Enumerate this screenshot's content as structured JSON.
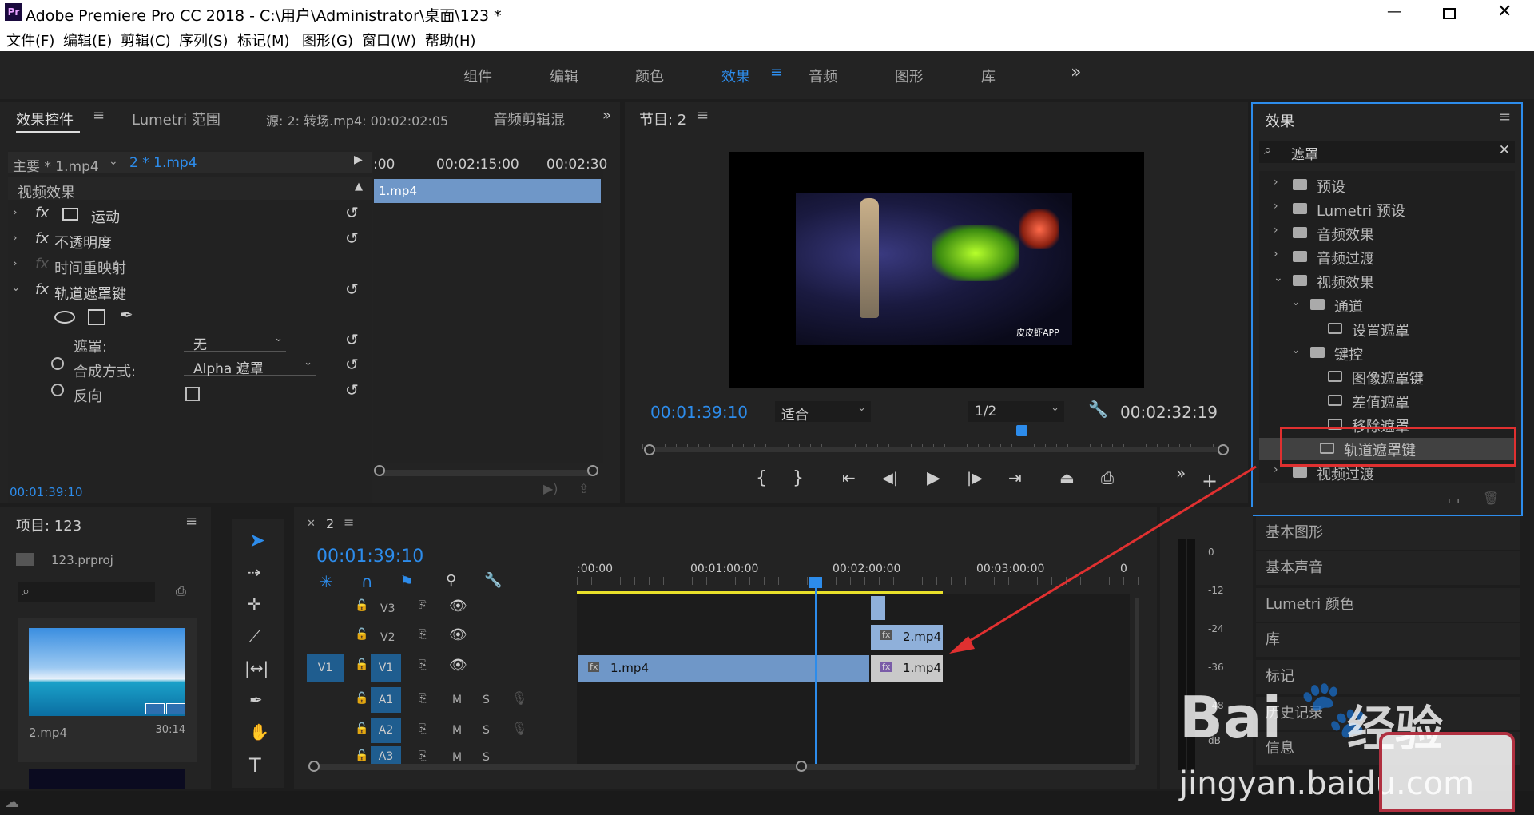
{
  "app": {
    "title": "Adobe Premiere Pro CC 2018 - C:\\用户\\Administrator\\桌面\\123 *",
    "logo": "Pr"
  },
  "menu": [
    "文件(F)",
    "编辑(E)",
    "剪辑(C)",
    "序列(S)",
    "标记(M)",
    "图形(G)",
    "窗口(W)",
    "帮助(H)"
  ],
  "workspaces": {
    "items": [
      "组件",
      "编辑",
      "颜色",
      "效果",
      "音频",
      "图形",
      "库"
    ],
    "active": "效果",
    "more": "»"
  },
  "effect_controls": {
    "tabs": [
      "效果控件",
      "Lumetri 范围",
      "源: 2: 转场.mp4: 00:02:02:05",
      "音频剪辑混"
    ],
    "master": "主要 * 1.mp4",
    "clip": "2 * 1.mp4",
    "times": [
      ":00",
      "00:02:15:00",
      "00:02:30"
    ],
    "clip_bar": "1.mp4",
    "section": "视频效果",
    "fx": [
      {
        "label": "运动"
      },
      {
        "label": "不透明度"
      },
      {
        "label": "时间重映射"
      },
      {
        "label": "轨道遮罩键"
      }
    ],
    "params": {
      "mask_label": "遮罩:",
      "mask_value": "无",
      "composite_label": "合成方式:",
      "composite_value": "Alpha 遮罩",
      "reverse_label": "反向"
    },
    "timecode": "00:01:39:10"
  },
  "program": {
    "title": "节目: 2",
    "timecode": "00:01:39:10",
    "fit": "适合",
    "resolution": "1/2",
    "duration": "00:02:32:19",
    "watermark": "皮皮虾APP",
    "playhead": 0.65
  },
  "effects": {
    "title": "效果",
    "search": "遮罩",
    "tree": [
      {
        "label": "预设",
        "depth": 0
      },
      {
        "label": "Lumetri 预设",
        "depth": 0
      },
      {
        "label": "音频效果",
        "depth": 0
      },
      {
        "label": "音频过渡",
        "depth": 0
      },
      {
        "label": "视频效果",
        "depth": 0
      },
      {
        "label": "通道",
        "depth": 1
      },
      {
        "label": "设置遮罩",
        "depth": 2
      },
      {
        "label": "键控",
        "depth": 1
      },
      {
        "label": "图像遮罩键",
        "depth": 2
      },
      {
        "label": "差值遮罩",
        "depth": 2
      },
      {
        "label": "移除遮罩",
        "depth": 2
      },
      {
        "label": "轨道遮罩键",
        "depth": 2
      },
      {
        "label": "视频过渡",
        "depth": 0
      }
    ],
    "highlight_color": "#e03030"
  },
  "side_panels": [
    "基本图形",
    "基本声音",
    "Lumetri 颜色",
    "库",
    "标记",
    "历史记录",
    "信息"
  ],
  "project": {
    "title": "项目: 123",
    "file": "123.prproj",
    "items": [
      {
        "name": "2.mp4",
        "duration": "30:14"
      }
    ]
  },
  "timeline": {
    "seq": "2",
    "timecode": "00:01:39:10",
    "ruler": [
      ":00:00",
      "00:01:00:00",
      "00:02:00:00",
      "00:03:00:00",
      "0"
    ],
    "video_tracks": [
      "V3",
      "V2",
      "V1"
    ],
    "audio_tracks": [
      "A1",
      "A2",
      "A3"
    ],
    "src_track": "V1",
    "ms": [
      "M",
      "S"
    ],
    "clips": [
      {
        "track": "V2",
        "label": "2.mp4"
      },
      {
        "track": "V1",
        "label": "1.mp4"
      },
      {
        "track": "V1",
        "label": "1.mp4"
      }
    ]
  },
  "meter": {
    "labels": [
      "0",
      "-12",
      "-24",
      "-36",
      "-48",
      "dB"
    ]
  },
  "baidu": {
    "brand": "Bai",
    "du": "经验",
    "url": "jingyan.baidu.com"
  }
}
